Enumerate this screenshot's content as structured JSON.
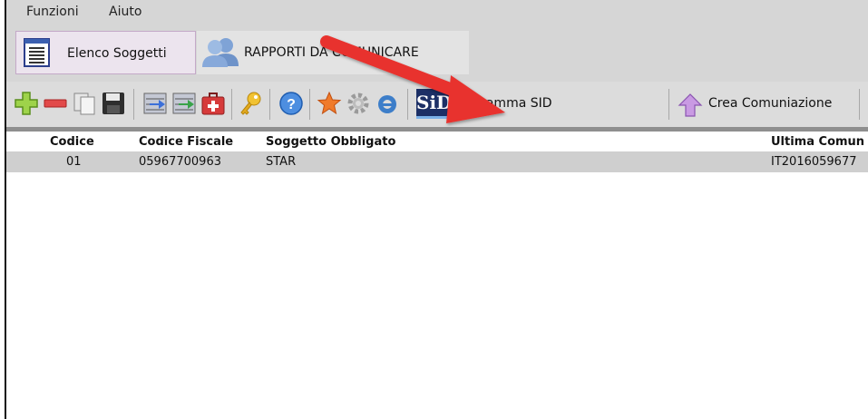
{
  "menu": {
    "items": [
      {
        "label": "Funzioni"
      },
      {
        "label": "Aiuto"
      }
    ]
  },
  "tabs": [
    {
      "label": "Elenco Soggetti",
      "icon": "list-icon",
      "active": true
    },
    {
      "label": "RAPPORTI DA COMUNICARE",
      "icon": "users-icon",
      "active": false
    }
  ],
  "toolbar": {
    "icons": [
      "add-icon",
      "remove-icon",
      "copy-icon",
      "save-icon",
      "import-icon",
      "export-icon",
      "first-aid-icon",
      "key-icon",
      "help-icon",
      "star-icon",
      "gear-icon",
      "ie-icon"
    ],
    "sid_badge": "SiD",
    "sid_label": "Programma SID",
    "crea_label": "Crea Comuniazione"
  },
  "table": {
    "columns": [
      "Codice",
      "Codice Fiscale",
      "Soggetto Obbligato",
      "Ultima Comun"
    ],
    "rows": [
      [
        "01",
        "05967700963",
        "STAR",
        "IT2016059677"
      ]
    ]
  },
  "colors": {
    "arrow": "#e8322f",
    "selected_row": "#cfcfcf",
    "chrome": "#d6d6d6"
  }
}
